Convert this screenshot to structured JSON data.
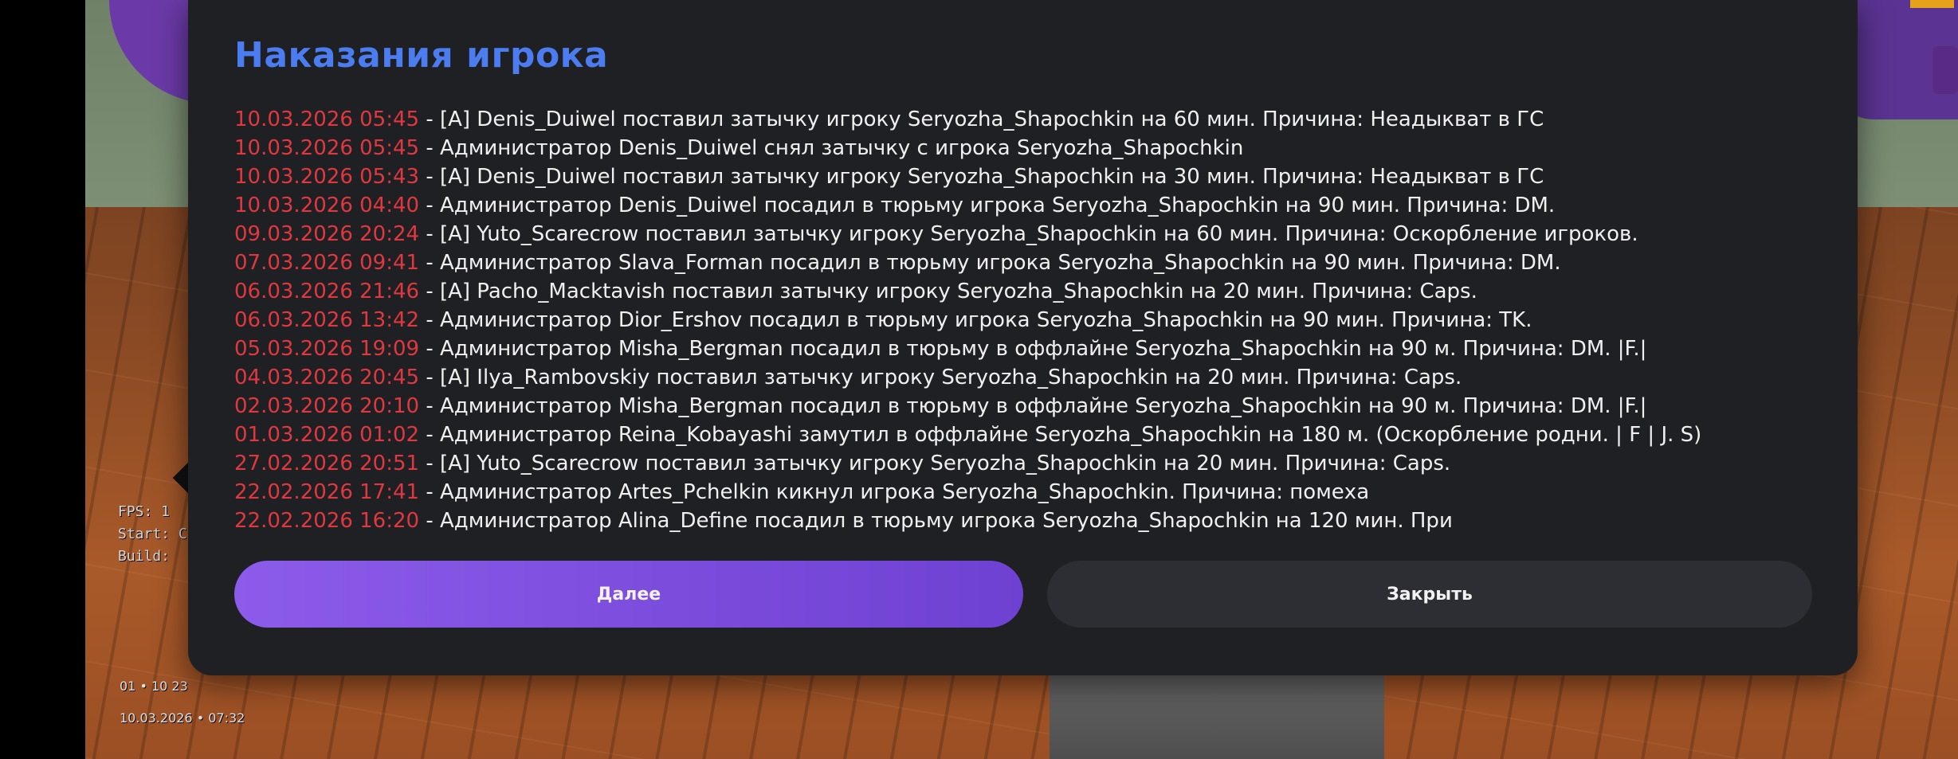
{
  "hud": {
    "fps_label": "FPS: 1",
    "start_label": "Start: C",
    "build_label": "Build: ",
    "clock_small": "01 • 10 23",
    "datetime": "10.03.2026 • 07:32"
  },
  "modal": {
    "title": "Наказания игрока",
    "entries": [
      {
        "date": "10.03.2026 05:45",
        "text": " - [A] Denis_Duiwel поставил затычку игроку Seryozha_Shapochkin на 60 мин. Причина: Неадыкват в ГС"
      },
      {
        "date": "10.03.2026 05:45",
        "text": " - Администратор Denis_Duiwel снял затычку с игрока Seryozha_Shapochkin"
      },
      {
        "date": "10.03.2026 05:43",
        "text": " - [A] Denis_Duiwel поставил затычку игроку Seryozha_Shapochkin на 30 мин. Причина: Неадыкват в ГС"
      },
      {
        "date": "10.03.2026 04:40",
        "text": " - Администратор Denis_Duiwel посадил в тюрьму игрока Seryozha_Shapochkin на 90 мин. Причина: DM."
      },
      {
        "date": "09.03.2026 20:24",
        "text": " - [A] Yuto_Scarecrow поставил затычку игроку Seryozha_Shapochkin на 60 мин. Причина: Оскорбление игроков."
      },
      {
        "date": "07.03.2026 09:41",
        "text": " - Администратор Slava_Forman посадил в тюрьму игрока Seryozha_Shapochkin на 90 мин. Причина: DM."
      },
      {
        "date": "06.03.2026 21:46",
        "text": " - [A] Pacho_Macktavish поставил затычку игроку Seryozha_Shapochkin на 20 мин. Причина: Caps."
      },
      {
        "date": "06.03.2026 13:42",
        "text": " - Администратор Dior_Ershov посадил в тюрьму игрока Seryozha_Shapochkin на 90 мин. Причина: TK."
      },
      {
        "date": "05.03.2026 19:09",
        "text": " - Администратор Misha_Bergman посадил в тюрьму в оффлайне Seryozha_Shapochkin на 90 м. Причина: DM. |F.|"
      },
      {
        "date": "04.03.2026 20:45",
        "text": " - [A] Ilya_Rambovskiy поставил затычку игроку Seryozha_Shapochkin на 20 мин. Причина: Caps."
      },
      {
        "date": "02.03.2026 20:10",
        "text": " - Администратор Misha_Bergman посадил в тюрьму в оффлайне Seryozha_Shapochkin на 90 м. Причина: DM. |F.|"
      },
      {
        "date": "01.03.2026 01:02",
        "text": " - Администратор Reina_Kobayashi замутил в оффлайне Seryozha_Shapochkin на 180 м. (Оскорбление родни. | F | J. S)"
      },
      {
        "date": "27.02.2026 20:51",
        "text": " - [A] Yuto_Scarecrow поставил затычку игроку Seryozha_Shapochkin на 20 мин. Причина: Caps."
      },
      {
        "date": "22.02.2026 17:41",
        "text": " - Администратор Artes_Pchelkin кикнул игрока Seryozha_Shapochkin. Причина: помеха"
      },
      {
        "date": "22.02.2026 16:20",
        "text": " - Администратор Alina_Define посадил в тюрьму игрока Seryozha_Shapochkin на 120 мин. При"
      }
    ],
    "next_label": "Далее",
    "close_label": "Закрыть"
  },
  "colors": {
    "title": "#4c7df0",
    "date": "#e0383f",
    "next_button": "#7f4fe0",
    "close_button": "#2d2e33",
    "panel": "#1f2024"
  }
}
